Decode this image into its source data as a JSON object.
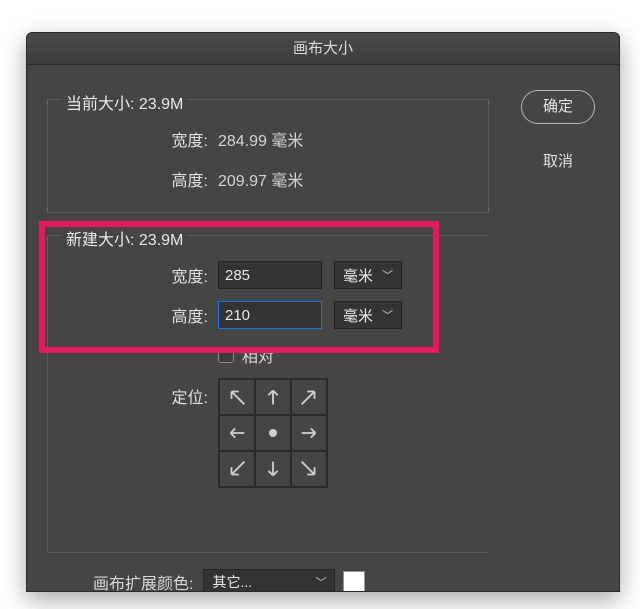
{
  "title": "画布大小",
  "buttons": {
    "ok": "确定",
    "cancel": "取消"
  },
  "current": {
    "legend_prefix": "当前大小: ",
    "legend_value": "23.9M",
    "width_label": "宽度:",
    "width_value": "284.99 毫米",
    "height_label": "高度:",
    "height_value": "209.97 毫米"
  },
  "newsize": {
    "legend_prefix": "新建大小: ",
    "legend_value": "23.9M",
    "width_label": "宽度:",
    "width_value": "285",
    "height_label": "高度:",
    "height_value": "210",
    "unit": "毫米",
    "relative_label": "相对",
    "anchor_label": "定位:"
  },
  "extension": {
    "label": "画布扩展颜色:",
    "value": "其它...",
    "swatch": "#ffffff"
  }
}
